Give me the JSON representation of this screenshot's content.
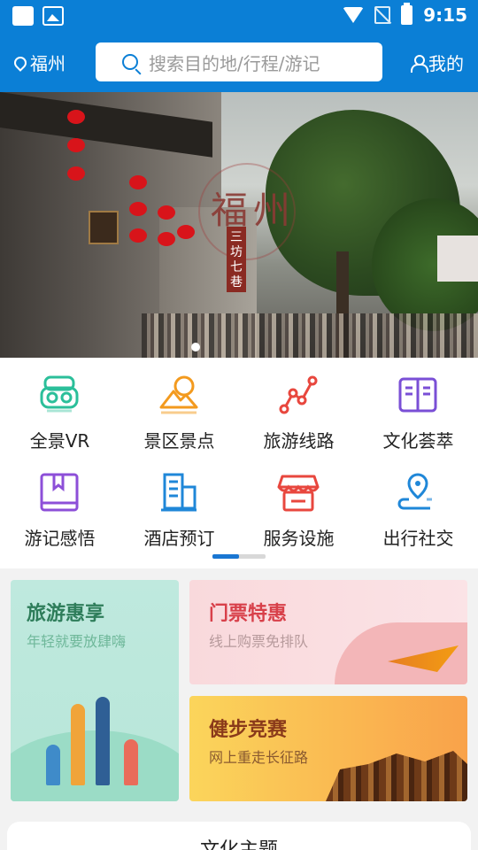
{
  "status_bar": {
    "time": "9:15"
  },
  "header": {
    "location": "福州",
    "search_placeholder": "搜索目的地/行程/游记",
    "mine": "我的"
  },
  "banner": {
    "title": "福州",
    "subtitle": "三坊七巷",
    "dot_count": 1,
    "active_dot": 0
  },
  "grid": {
    "items": [
      {
        "label": "全景VR",
        "icon": "vr-headset-icon",
        "color": "#2bbf9a"
      },
      {
        "label": "景区景点",
        "icon": "mountain-icon",
        "color": "#f39a1e"
      },
      {
        "label": "旅游线路",
        "icon": "route-icon",
        "color": "#e8473e"
      },
      {
        "label": "文化荟萃",
        "icon": "book-open-icon",
        "color": "#7a4fd6"
      },
      {
        "label": "游记感悟",
        "icon": "notebook-icon",
        "color": "#8d4fd8"
      },
      {
        "label": "酒店预订",
        "icon": "building-icon",
        "color": "#1f87d8"
      },
      {
        "label": "服务设施",
        "icon": "shop-icon",
        "color": "#e8473e"
      },
      {
        "label": "出行社交",
        "icon": "location-route-icon",
        "color": "#1f87d8"
      }
    ],
    "page_index": 0,
    "page_count": 2
  },
  "promos": {
    "travel": {
      "title": "旅游惠享",
      "subtitle": "年轻就要放肆嗨"
    },
    "ticket": {
      "title": "门票特惠",
      "subtitle": "线上购票免排队"
    },
    "walk": {
      "title": "健步竞赛",
      "subtitle": "网上重走长征路"
    }
  },
  "section": {
    "title": "文化主题"
  }
}
